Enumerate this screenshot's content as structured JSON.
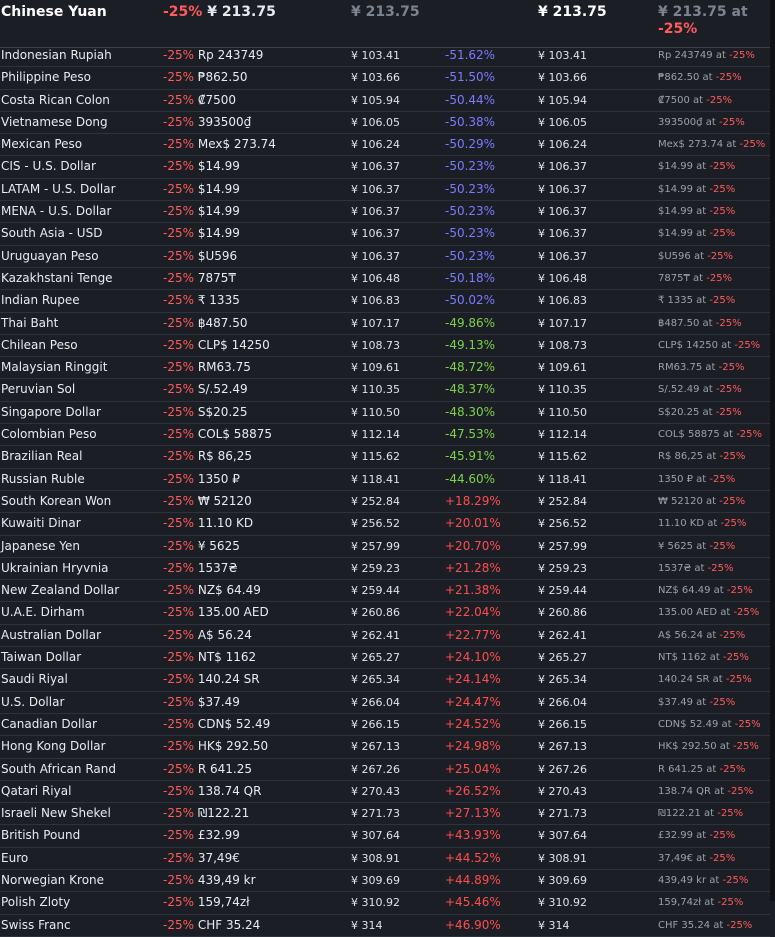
{
  "header": {
    "currency": "Chinese Yuan",
    "discount": "-25%",
    "price": "¥ 213.75",
    "base_price": "¥ 213.75",
    "converted_price": "¥ 213.75",
    "alt_price": "¥ 213.75 at",
    "alt_discount": "-25%"
  },
  "colors": {
    "discount": "#ff5b5b",
    "cheaper_strong": "#7b7bff",
    "cheaper_mild": "#7bd24b",
    "pricier": "#ff4d4d",
    "background": "#1b1e25"
  },
  "rows": [
    {
      "name": "Indonesian Rupiah",
      "discount": "-25%",
      "price": "Rp 243749",
      "base": "¥ 103.41",
      "diff": "-51.62%",
      "tone": "blue",
      "conv": "¥ 103.41",
      "alt_price": "Rp 243749 at ",
      "alt_discount": "-25%"
    },
    {
      "name": "Philippine Peso",
      "discount": "-25%",
      "price": "₱862.50",
      "base": "¥ 103.66",
      "diff": "-51.50%",
      "tone": "blue",
      "conv": "¥ 103.66",
      "alt_price": "₱862.50 at ",
      "alt_discount": "-25%"
    },
    {
      "name": "Costa Rican Colon",
      "discount": "-25%",
      "price": "₡7500",
      "base": "¥ 105.94",
      "diff": "-50.44%",
      "tone": "blue",
      "conv": "¥ 105.94",
      "alt_price": "₡7500 at ",
      "alt_discount": "-25%"
    },
    {
      "name": "Vietnamese Dong",
      "discount": "-25%",
      "price": "393500₫",
      "base": "¥ 106.05",
      "diff": "-50.38%",
      "tone": "blue",
      "conv": "¥ 106.05",
      "alt_price": "393500₫ at ",
      "alt_discount": "-25%"
    },
    {
      "name": "Mexican Peso",
      "discount": "-25%",
      "price": "Mex$ 273.74",
      "base": "¥ 106.24",
      "diff": "-50.29%",
      "tone": "blue",
      "conv": "¥ 106.24",
      "alt_price": "Mex$ 273.74 at ",
      "alt_discount": "-25%"
    },
    {
      "name": "CIS - U.S. Dollar",
      "discount": "-25%",
      "price": "$14.99",
      "base": "¥ 106.37",
      "diff": "-50.23%",
      "tone": "blue",
      "conv": "¥ 106.37",
      "alt_price": "$14.99 at ",
      "alt_discount": "-25%"
    },
    {
      "name": "LATAM - U.S. Dollar",
      "discount": "-25%",
      "price": "$14.99",
      "base": "¥ 106.37",
      "diff": "-50.23%",
      "tone": "blue",
      "conv": "¥ 106.37",
      "alt_price": "$14.99 at ",
      "alt_discount": "-25%"
    },
    {
      "name": "MENA - U.S. Dollar",
      "discount": "-25%",
      "price": "$14.99",
      "base": "¥ 106.37",
      "diff": "-50.23%",
      "tone": "blue",
      "conv": "¥ 106.37",
      "alt_price": "$14.99 at ",
      "alt_discount": "-25%"
    },
    {
      "name": "South Asia - USD",
      "discount": "-25%",
      "price": "$14.99",
      "base": "¥ 106.37",
      "diff": "-50.23%",
      "tone": "blue",
      "conv": "¥ 106.37",
      "alt_price": "$14.99 at ",
      "alt_discount": "-25%"
    },
    {
      "name": "Uruguayan Peso",
      "discount": "-25%",
      "price": "$U596",
      "base": "¥ 106.37",
      "diff": "-50.23%",
      "tone": "blue",
      "conv": "¥ 106.37",
      "alt_price": "$U596 at ",
      "alt_discount": "-25%"
    },
    {
      "name": "Kazakhstani Tenge",
      "discount": "-25%",
      "price": "7875₸",
      "base": "¥ 106.48",
      "diff": "-50.18%",
      "tone": "blue",
      "conv": "¥ 106.48",
      "alt_price": "7875₸ at ",
      "alt_discount": "-25%"
    },
    {
      "name": "Indian Rupee",
      "discount": "-25%",
      "price": "₹ 1335",
      "base": "¥ 106.83",
      "diff": "-50.02%",
      "tone": "blue",
      "conv": "¥ 106.83",
      "alt_price": "₹ 1335 at ",
      "alt_discount": "-25%"
    },
    {
      "name": "Thai Baht",
      "discount": "-25%",
      "price": "฿487.50",
      "base": "¥ 107.17",
      "diff": "-49.86%",
      "tone": "green",
      "conv": "¥ 107.17",
      "alt_price": "฿487.50 at ",
      "alt_discount": "-25%"
    },
    {
      "name": "Chilean Peso",
      "discount": "-25%",
      "price": "CLP$ 14250",
      "base": "¥ 108.73",
      "diff": "-49.13%",
      "tone": "green",
      "conv": "¥ 108.73",
      "alt_price": "CLP$ 14250 at ",
      "alt_discount": "-25%"
    },
    {
      "name": "Malaysian Ringgit",
      "discount": "-25%",
      "price": "RM63.75",
      "base": "¥ 109.61",
      "diff": "-48.72%",
      "tone": "green",
      "conv": "¥ 109.61",
      "alt_price": "RM63.75 at ",
      "alt_discount": "-25%"
    },
    {
      "name": "Peruvian Sol",
      "discount": "-25%",
      "price": "S/.52.49",
      "base": "¥ 110.35",
      "diff": "-48.37%",
      "tone": "green",
      "conv": "¥ 110.35",
      "alt_price": "S/.52.49 at ",
      "alt_discount": "-25%"
    },
    {
      "name": "Singapore Dollar",
      "discount": "-25%",
      "price": "S$20.25",
      "base": "¥ 110.50",
      "diff": "-48.30%",
      "tone": "green",
      "conv": "¥ 110.50",
      "alt_price": "S$20.25 at ",
      "alt_discount": "-25%"
    },
    {
      "name": "Colombian Peso",
      "discount": "-25%",
      "price": "COL$ 58875",
      "base": "¥ 112.14",
      "diff": "-47.53%",
      "tone": "green",
      "conv": "¥ 112.14",
      "alt_price": "COL$ 58875 at ",
      "alt_discount": "-25%"
    },
    {
      "name": "Brazilian Real",
      "discount": "-25%",
      "price": "R$ 86,25",
      "base": "¥ 115.62",
      "diff": "-45.91%",
      "tone": "green",
      "conv": "¥ 115.62",
      "alt_price": "R$ 86,25 at ",
      "alt_discount": "-25%"
    },
    {
      "name": "Russian Ruble",
      "discount": "-25%",
      "price": "1350 ₽",
      "base": "¥ 118.41",
      "diff": "-44.60%",
      "tone": "green",
      "conv": "¥ 118.41",
      "alt_price": "1350 ₽ at ",
      "alt_discount": "-25%"
    },
    {
      "name": "South Korean Won",
      "discount": "-25%",
      "price": "₩ 52120",
      "base": "¥ 252.84",
      "diff": "+18.29%",
      "tone": "red",
      "conv": "¥ 252.84",
      "alt_price": "₩ 52120 at ",
      "alt_discount": "-25%"
    },
    {
      "name": "Kuwaiti Dinar",
      "discount": "-25%",
      "price": "11.10 KD",
      "base": "¥ 256.52",
      "diff": "+20.01%",
      "tone": "red",
      "conv": "¥ 256.52",
      "alt_price": "11.10 KD at ",
      "alt_discount": "-25%"
    },
    {
      "name": "Japanese Yen",
      "discount": "-25%",
      "price": "¥ 5625",
      "base": "¥ 257.99",
      "diff": "+20.70%",
      "tone": "red",
      "conv": "¥ 257.99",
      "alt_price": "¥ 5625 at ",
      "alt_discount": "-25%"
    },
    {
      "name": "Ukrainian Hryvnia",
      "discount": "-25%",
      "price": "1537₴",
      "base": "¥ 259.23",
      "diff": "+21.28%",
      "tone": "red",
      "conv": "¥ 259.23",
      "alt_price": "1537₴ at ",
      "alt_discount": "-25%"
    },
    {
      "name": "New Zealand Dollar",
      "discount": "-25%",
      "price": "NZ$ 64.49",
      "base": "¥ 259.44",
      "diff": "+21.38%",
      "tone": "red",
      "conv": "¥ 259.44",
      "alt_price": "NZ$ 64.49 at ",
      "alt_discount": "-25%"
    },
    {
      "name": "U.A.E. Dirham",
      "discount": "-25%",
      "price": "135.00 AED",
      "base": "¥ 260.86",
      "diff": "+22.04%",
      "tone": "red",
      "conv": "¥ 260.86",
      "alt_price": "135.00 AED at ",
      "alt_discount": "-25%"
    },
    {
      "name": "Australian Dollar",
      "discount": "-25%",
      "price": "A$ 56.24",
      "base": "¥ 262.41",
      "diff": "+22.77%",
      "tone": "red",
      "conv": "¥ 262.41",
      "alt_price": "A$ 56.24 at ",
      "alt_discount": "-25%"
    },
    {
      "name": "Taiwan Dollar",
      "discount": "-25%",
      "price": "NT$ 1162",
      "base": "¥ 265.27",
      "diff": "+24.10%",
      "tone": "red",
      "conv": "¥ 265.27",
      "alt_price": "NT$ 1162 at ",
      "alt_discount": "-25%"
    },
    {
      "name": "Saudi Riyal",
      "discount": "-25%",
      "price": "140.24 SR",
      "base": "¥ 265.34",
      "diff": "+24.14%",
      "tone": "red",
      "conv": "¥ 265.34",
      "alt_price": "140.24 SR at ",
      "alt_discount": "-25%"
    },
    {
      "name": "U.S. Dollar",
      "discount": "-25%",
      "price": "$37.49",
      "base": "¥ 266.04",
      "diff": "+24.47%",
      "tone": "red",
      "conv": "¥ 266.04",
      "alt_price": "$37.49 at ",
      "alt_discount": "-25%"
    },
    {
      "name": "Canadian Dollar",
      "discount": "-25%",
      "price": "CDN$ 52.49",
      "base": "¥ 266.15",
      "diff": "+24.52%",
      "tone": "red",
      "conv": "¥ 266.15",
      "alt_price": "CDN$ 52.49 at ",
      "alt_discount": "-25%"
    },
    {
      "name": "Hong Kong Dollar",
      "discount": "-25%",
      "price": "HK$ 292.50",
      "base": "¥ 267.13",
      "diff": "+24.98%",
      "tone": "red",
      "conv": "¥ 267.13",
      "alt_price": "HK$ 292.50 at ",
      "alt_discount": "-25%"
    },
    {
      "name": "South African Rand",
      "discount": "-25%",
      "price": "R 641.25",
      "base": "¥ 267.26",
      "diff": "+25.04%",
      "tone": "red",
      "conv": "¥ 267.26",
      "alt_price": "R 641.25 at ",
      "alt_discount": "-25%"
    },
    {
      "name": "Qatari Riyal",
      "discount": "-25%",
      "price": "138.74 QR",
      "base": "¥ 270.43",
      "diff": "+26.52%",
      "tone": "red",
      "conv": "¥ 270.43",
      "alt_price": "138.74 QR at ",
      "alt_discount": "-25%"
    },
    {
      "name": "Israeli New Shekel",
      "discount": "-25%",
      "price": "₪122.21",
      "base": "¥ 271.73",
      "diff": "+27.13%",
      "tone": "red",
      "conv": "¥ 271.73",
      "alt_price": "₪122.21 at ",
      "alt_discount": "-25%"
    },
    {
      "name": "British Pound",
      "discount": "-25%",
      "price": "£32.99",
      "base": "¥ 307.64",
      "diff": "+43.93%",
      "tone": "red",
      "conv": "¥ 307.64",
      "alt_price": "£32.99 at ",
      "alt_discount": "-25%"
    },
    {
      "name": "Euro",
      "discount": "-25%",
      "price": "37,49€",
      "base": "¥ 308.91",
      "diff": "+44.52%",
      "tone": "red",
      "conv": "¥ 308.91",
      "alt_price": "37,49€ at ",
      "alt_discount": "-25%"
    },
    {
      "name": "Norwegian Krone",
      "discount": "-25%",
      "price": "439,49 kr",
      "base": "¥ 309.69",
      "diff": "+44.89%",
      "tone": "red",
      "conv": "¥ 309.69",
      "alt_price": "439,49 kr at ",
      "alt_discount": "-25%"
    },
    {
      "name": "Polish Zloty",
      "discount": "-25%",
      "price": "159,74zł",
      "base": "¥ 310.92",
      "diff": "+45.46%",
      "tone": "red",
      "conv": "¥ 310.92",
      "alt_price": "159,74zł at ",
      "alt_discount": "-25%"
    },
    {
      "name": "Swiss Franc",
      "discount": "-25%",
      "price": "CHF 35.24",
      "base": "¥ 314",
      "diff": "+46.90%",
      "tone": "red",
      "conv": "¥ 314",
      "alt_price": "CHF 35.24 at ",
      "alt_discount": "-25%"
    }
  ]
}
